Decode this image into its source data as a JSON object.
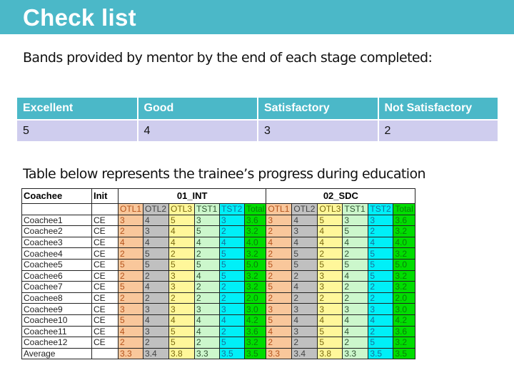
{
  "title": "Check list",
  "subtitle": "Bands provided by mentor by the end of each stage completed:",
  "bands": {
    "headers": [
      "Excellent",
      "Good",
      "Satisfactory",
      "Not Satisfactory"
    ],
    "values": [
      "5",
      "4",
      "3",
      "2"
    ]
  },
  "caption": "Table below represents the trainee’s progress during education",
  "progress_table": {
    "col_coachee": "Coachee",
    "col_init": "Init",
    "groups": [
      "01_INT",
      "02_SDC"
    ],
    "subcols": [
      "OTL1",
      "OTL2",
      "OTL3",
      "TST1",
      "TST2",
      "Total"
    ],
    "rows": [
      {
        "name": "Coachee1",
        "init": "CE",
        "int": [
          "3",
          "4",
          "5",
          "3",
          "3",
          "3.6"
        ],
        "sdc": [
          "3",
          "4",
          "5",
          "3",
          "3",
          "3.6"
        ]
      },
      {
        "name": "Coachee2",
        "init": "CE",
        "int": [
          "2",
          "3",
          "4",
          "5",
          "2",
          "3.2"
        ],
        "sdc": [
          "2",
          "3",
          "4",
          "5",
          "2",
          "3.2"
        ]
      },
      {
        "name": "Coachee3",
        "init": "CE",
        "int": [
          "4",
          "4",
          "4",
          "4",
          "4",
          "4.0"
        ],
        "sdc": [
          "4",
          "4",
          "4",
          "4",
          "4",
          "4.0"
        ]
      },
      {
        "name": "Coachee4",
        "init": "CE",
        "int": [
          "2",
          "5",
          "2",
          "2",
          "5",
          "3.2"
        ],
        "sdc": [
          "2",
          "5",
          "2",
          "2",
          "5",
          "3.2"
        ]
      },
      {
        "name": "Coachee5",
        "init": "CE",
        "int": [
          "5",
          "5",
          "5",
          "5",
          "5",
          "5.0"
        ],
        "sdc": [
          "5",
          "5",
          "5",
          "5",
          "5",
          "5.0"
        ]
      },
      {
        "name": "Coachee6",
        "init": "CE",
        "int": [
          "2",
          "2",
          "3",
          "4",
          "5",
          "3.2"
        ],
        "sdc": [
          "2",
          "2",
          "3",
          "4",
          "5",
          "3.2"
        ]
      },
      {
        "name": "Coachee7",
        "init": "CE",
        "int": [
          "5",
          "4",
          "3",
          "2",
          "2",
          "3.2"
        ],
        "sdc": [
          "5",
          "4",
          "3",
          "2",
          "2",
          "3.2"
        ]
      },
      {
        "name": "Coachee8",
        "init": "CE",
        "int": [
          "2",
          "2",
          "2",
          "2",
          "2",
          "2.0"
        ],
        "sdc": [
          "2",
          "2",
          "2",
          "2",
          "2",
          "2.0"
        ]
      },
      {
        "name": "Coachee9",
        "init": "CE",
        "int": [
          "3",
          "3",
          "3",
          "3",
          "3",
          "3.0"
        ],
        "sdc": [
          "3",
          "3",
          "3",
          "3",
          "3",
          "3.0"
        ]
      },
      {
        "name": "Coachee10",
        "init": "CE",
        "int": [
          "5",
          "4",
          "4",
          "4",
          "4",
          "4.2"
        ],
        "sdc": [
          "5",
          "4",
          "4",
          "4",
          "4",
          "4.2"
        ]
      },
      {
        "name": "Coachee11",
        "init": "CE",
        "int": [
          "4",
          "3",
          "5",
          "4",
          "2",
          "3.6"
        ],
        "sdc": [
          "4",
          "3",
          "5",
          "4",
          "2",
          "3.6"
        ]
      },
      {
        "name": "Coachee12",
        "init": "CE",
        "int": [
          "2",
          "2",
          "5",
          "2",
          "5",
          "3.2"
        ],
        "sdc": [
          "2",
          "2",
          "5",
          "2",
          "5",
          "3.2"
        ]
      },
      {
        "name": "Average",
        "init": "",
        "int": [
          "3.3",
          "3.4",
          "3.8",
          "3.3",
          "3.5",
          "3.5"
        ],
        "sdc": [
          "3.3",
          "3.4",
          "3.8",
          "3.3",
          "3.5",
          "3.5"
        ]
      }
    ]
  },
  "colors": {
    "accent": "#4bb8c8",
    "band_values_bg": "#cfcdee",
    "otl1": "#f9c79b",
    "otl2": "#c0c0c0",
    "otl3": "#fff79a",
    "tst1": "#ccf7cc",
    "tst2": "#00f0f8",
    "total": "#00dd00"
  }
}
